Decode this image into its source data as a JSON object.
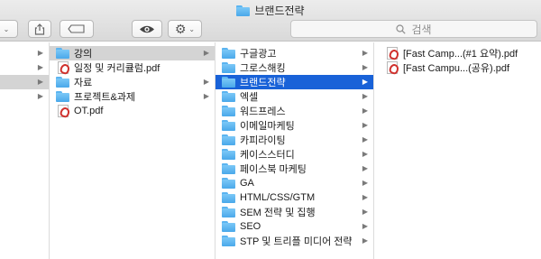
{
  "window": {
    "title": "브랜드전략"
  },
  "toolbar": {
    "share_icon": "share-icon",
    "tag_icon": "tag-icon",
    "quicklook_icon": "eye-icon",
    "action_icon": "gear-icon"
  },
  "search": {
    "placeholder": "검색"
  },
  "columns": {
    "col2": {
      "items": [
        {
          "label": "강의",
          "type": "folder",
          "selected": true
        },
        {
          "label": "일정 및 커리큘럼.pdf",
          "type": "pdf"
        },
        {
          "label": "자료",
          "type": "folder"
        },
        {
          "label": "프로젝트&과제",
          "type": "folder"
        },
        {
          "label": "OT.pdf",
          "type": "pdf"
        }
      ]
    },
    "col3": {
      "items": [
        {
          "label": "구글광고",
          "type": "folder"
        },
        {
          "label": "그로스해킹",
          "type": "folder"
        },
        {
          "label": "브랜드전략",
          "type": "folder",
          "selected": true
        },
        {
          "label": "엑셀",
          "type": "folder"
        },
        {
          "label": "워드프레스",
          "type": "folder"
        },
        {
          "label": "이메일마케팅",
          "type": "folder"
        },
        {
          "label": "카피라이팅",
          "type": "folder"
        },
        {
          "label": "케이스스터디",
          "type": "folder"
        },
        {
          "label": "페이스북 마케팅",
          "type": "folder"
        },
        {
          "label": "GA",
          "type": "folder"
        },
        {
          "label": "HTML/CSS/GTM",
          "type": "folder"
        },
        {
          "label": "SEM 전략 및 집행",
          "type": "folder"
        },
        {
          "label": "SEO",
          "type": "folder"
        },
        {
          "label": "STP 및 트리플 미디어 전략",
          "type": "folder"
        }
      ]
    },
    "col4": {
      "items": [
        {
          "label": "[Fast Camp...(#1 요약).pdf",
          "type": "pdf"
        },
        {
          "label": "[Fast Campu...(공유).pdf",
          "type": "pdf"
        }
      ]
    }
  }
}
